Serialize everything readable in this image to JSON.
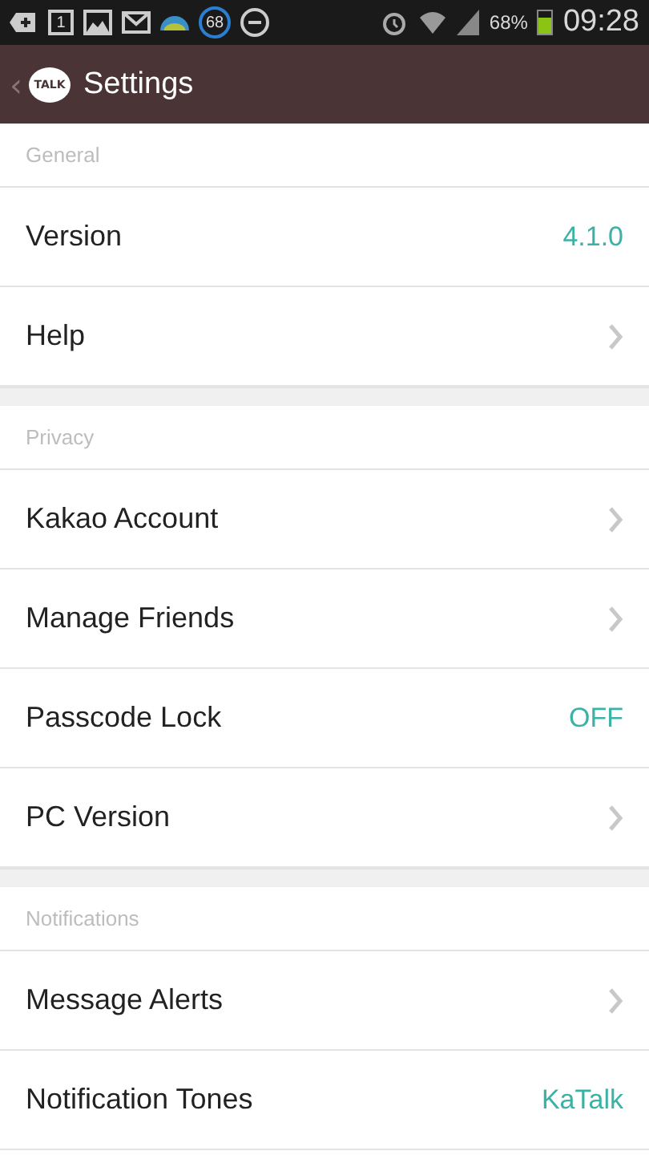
{
  "status_bar": {
    "calendar_day": "1",
    "badge_count": "68",
    "battery_percent": "68%",
    "time": "09:28"
  },
  "header": {
    "back": "‹",
    "logo_text": "TALK",
    "title": "Settings"
  },
  "sections": [
    {
      "title": "General",
      "rows": [
        {
          "kind": "value",
          "label": "Version",
          "value": "4.1.0"
        },
        {
          "kind": "link",
          "label": "Help"
        }
      ]
    },
    {
      "title": "Privacy",
      "rows": [
        {
          "kind": "link",
          "label": "Kakao Account"
        },
        {
          "kind": "link",
          "label": "Manage Friends"
        },
        {
          "kind": "value",
          "label": "Passcode Lock",
          "value": "OFF"
        },
        {
          "kind": "link",
          "label": "PC Version"
        }
      ]
    },
    {
      "title": "Notifications",
      "rows": [
        {
          "kind": "link",
          "label": "Message Alerts"
        },
        {
          "kind": "value",
          "label": "Notification Tones",
          "value": "KaTalk"
        }
      ]
    }
  ]
}
